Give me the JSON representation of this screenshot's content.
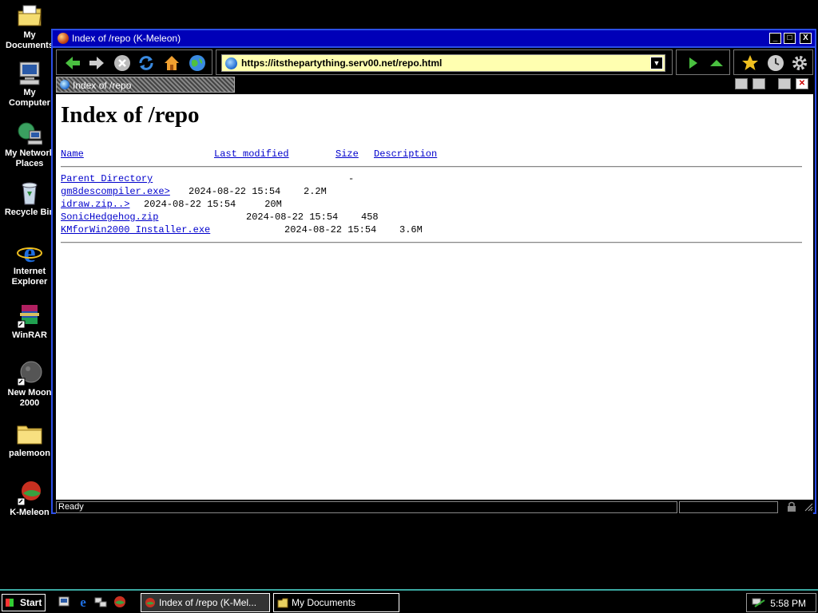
{
  "desktop": {
    "icons": [
      {
        "label": "My\nDocuments",
        "icon": "my-documents-icon"
      },
      {
        "label": "My\nComputer",
        "icon": "my-computer-icon"
      },
      {
        "label": "My Network\nPlaces",
        "icon": "network-places-icon"
      },
      {
        "label": "Recycle Bin",
        "icon": "recycle-bin-icon"
      },
      {
        "label": "Internet\nExplorer",
        "icon": "internet-explorer-icon"
      },
      {
        "label": "WinRAR",
        "icon": "winrar-icon"
      },
      {
        "label": "New Moon\n2000",
        "icon": "new-moon-icon"
      },
      {
        "label": "palemoon",
        "icon": "folder-icon"
      },
      {
        "label": "K-Meleon",
        "icon": "k-meleon-icon"
      }
    ]
  },
  "window": {
    "title": "Index of /repo (K-Meleon)",
    "buttons": {
      "minimize": "_",
      "maximize": "□",
      "close": "X"
    }
  },
  "toolbar": {
    "url": "https://itsthepartything.serv00.net/repo.html"
  },
  "tab": {
    "label": "Index of /repo"
  },
  "page": {
    "heading": "Index of /repo",
    "columns": {
      "name": "Name",
      "modified": "Last modified",
      "size": "Size",
      "description": "Description"
    },
    "parent": {
      "name": "Parent Directory",
      "size": "-"
    },
    "rows": [
      {
        "name": "gm8descompiler.exe>",
        "modified": "2024-08-22 15:54",
        "size": "2.2M"
      },
      {
        "name": "idraw.zip..>",
        "modified": "2024-08-22 15:54",
        "size": " 20M"
      },
      {
        "name": "SonicHedgehog.zip",
        "modified": "2024-08-22 15:54",
        "size": "458"
      },
      {
        "name": "KMforWin2000 Installer.exe",
        "modified": "2024-08-22 15:54",
        "size": "3.6M"
      }
    ]
  },
  "status": {
    "text": "Ready"
  },
  "taskbar": {
    "start_label": "Start",
    "tasks": [
      {
        "label": "Index of /repo (K-Mel...",
        "icon": "k-meleon-icon"
      },
      {
        "label": "My Documents",
        "icon": "my-documents-icon"
      }
    ],
    "clock": "5:58 PM"
  }
}
